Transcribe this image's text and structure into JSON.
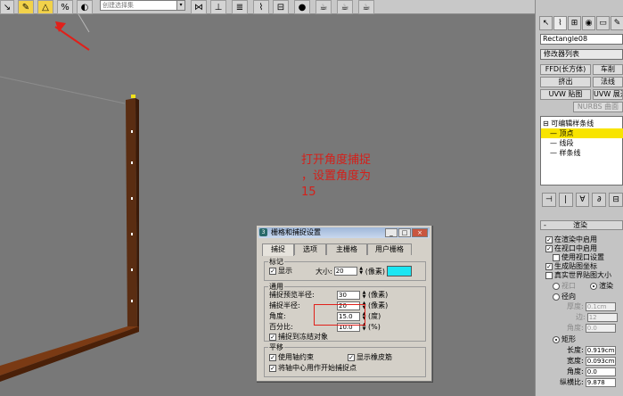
{
  "toolbar": {
    "combo_text": "创建选择集",
    "combo_arrow": "▾"
  },
  "annotation": {
    "line1": "打开角度捕捉",
    "line2": "，设置角度为",
    "line3": "15"
  },
  "panel": {
    "tabs": [
      "↖",
      "⌇",
      "⊞",
      "◉",
      "▭",
      "✎"
    ],
    "object_name": "Rectangle08",
    "modifier_list": "修改器列表",
    "buttons": {
      "ffd_box": "FFD(长方体)",
      "turbosmooth": "车削",
      "extrude": "挤出",
      "normal": "法线",
      "uvw_map": "UVW 贴图",
      "uvw_expand": "UVW 展开",
      "nurbs": "NURBS 曲面"
    },
    "stack": {
      "root": "可编辑样条线",
      "vertex": "顶点",
      "segment": "线段",
      "spline": "样条线"
    },
    "stack_tools": [
      "⊣",
      "|",
      "∀",
      "∂",
      "⊟"
    ],
    "render": {
      "header": "渲染",
      "enable_render": "在渲染中启用",
      "enable_viewport": "在视口中启用",
      "use_viewport": "使用视口设置",
      "gen_mapping": "生成贴图坐标",
      "real_world": "真实世界贴图大小",
      "viewport": "视口",
      "render_opt": "渲染",
      "radial": "径向",
      "thickness_label": "厚度:",
      "thickness_val": "0.1cm",
      "sides_label": "边:",
      "sides_val": "12",
      "angle_label": "角度:",
      "angle_val": "0.0",
      "rect": "矩形",
      "length_label": "长度:",
      "length_val": "0.919cm",
      "width_label": "宽度:",
      "width_val": "0.093cm",
      "angle2_label": "角度:",
      "angle2_val": "0.0",
      "aspect_label": "纵横比:",
      "aspect_val": "9.878"
    }
  },
  "dialog": {
    "title": "栅格和捕捉设置",
    "minimize": "_",
    "maximize": "□",
    "close": "×",
    "tabs": [
      "捕捉",
      "选项",
      "主栅格",
      "用户栅格"
    ],
    "marker": {
      "label": "标记",
      "show": "显示",
      "size_label": "大小:",
      "size_val": "20",
      "size_unit": "(像素)"
    },
    "general": {
      "label": "通用",
      "preview_radius_label": "捕捉预览半径:",
      "preview_radius_val": "30",
      "snap_radius_label": "捕捉半径:",
      "snap_radius_val": "20",
      "angle_label": "角度:",
      "angle_val": "15.0",
      "angle_unit": "(度)",
      "percent_label": "百分比:",
      "percent_val": "10.0",
      "percent_unit": "(%)",
      "pixel_unit": "(像素)",
      "snap_frozen": "捕捉到冻结对象"
    },
    "translation": {
      "label": "平移",
      "use_axis": "使用轴约束",
      "show_rubber": "显示橡皮筋",
      "axis_center": "将轴中心用作开始捕捉点"
    }
  }
}
